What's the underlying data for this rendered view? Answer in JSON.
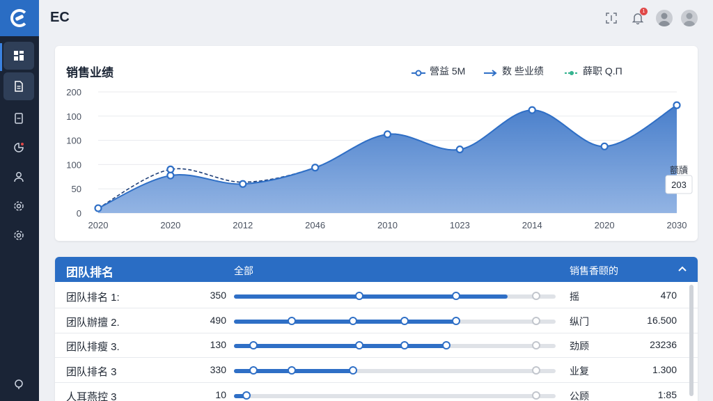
{
  "brand": "EC",
  "sidebar": {
    "items": [
      {
        "name": "dashboard-icon",
        "active": true
      },
      {
        "name": "document-icon",
        "active": true
      },
      {
        "name": "file-icon",
        "active": false
      },
      {
        "name": "pie-chart-icon",
        "active": false
      },
      {
        "name": "user-icon",
        "active": false
      },
      {
        "name": "settings-icon",
        "active": false
      },
      {
        "name": "settings-icon",
        "active": false
      },
      {
        "name": "help-icon",
        "active": false
      }
    ]
  },
  "header": {
    "icons": [
      "scan-icon",
      "bell-icon",
      "avatar",
      "avatar"
    ],
    "notification_badge": "1"
  },
  "chart_card": {
    "title": "销售业绩",
    "legend": [
      {
        "label": "營益 5M",
        "color": "#2f6fc6"
      },
      {
        "label": "数 些业绩",
        "color": "#2f6fc6"
      },
      {
        "label": "薛职 Q.Π",
        "color": "#35b38f"
      }
    ],
    "tooltip": {
      "label": "额牘",
      "value": "203"
    }
  },
  "chart_data": {
    "type": "area",
    "title": "销售业绩",
    "y_tick_labels": [
      "200",
      "100",
      "100",
      "100",
      "50",
      "0"
    ],
    "x_tick_labels": [
      "2020",
      "2020",
      "2012",
      "2046",
      "2010",
      "1023",
      "2014",
      "2020",
      "2030"
    ],
    "ylim": [
      0,
      200
    ],
    "series": [
      {
        "name": "營益 5M",
        "values": [
          8,
          62,
          48,
          75,
          130,
          105,
          170,
          110,
          178
        ]
      },
      {
        "name": "数 些业绩",
        "values": [
          8,
          72,
          51,
          75,
          130,
          105,
          170,
          110,
          178
        ]
      }
    ],
    "grid": true
  },
  "panel": {
    "title": "团队排名",
    "col_all": "全部",
    "col_sales": "销售香颐的",
    "rows": [
      {
        "name": "团队排名 1:",
        "num": "350",
        "fill": 0.85,
        "knobs": [
          0.39,
          0.69
        ],
        "cat": "摇",
        "val": "470"
      },
      {
        "name": "团队辦擅 2.",
        "num": "490",
        "fill": 0.69,
        "knobs": [
          0.18,
          0.37,
          0.53,
          0.69
        ],
        "cat": "纵门",
        "val": "16.500"
      },
      {
        "name": "团队排瘦 3.",
        "num": "130",
        "fill": 0.66,
        "knobs": [
          0.06,
          0.39,
          0.53,
          0.66
        ],
        "cat": "劲顾",
        "val": "23236"
      },
      {
        "name": "团队排名 3",
        "num": "330",
        "fill": 0.37,
        "knobs": [
          0.06,
          0.18,
          0.37
        ],
        "cat": "业复",
        "val": "1.300"
      },
      {
        "name": "人耳燕控 3",
        "num": "10",
        "fill": 0.04,
        "knobs": [
          0.04
        ],
        "cat": "公顾",
        "val": "1:85"
      }
    ]
  }
}
